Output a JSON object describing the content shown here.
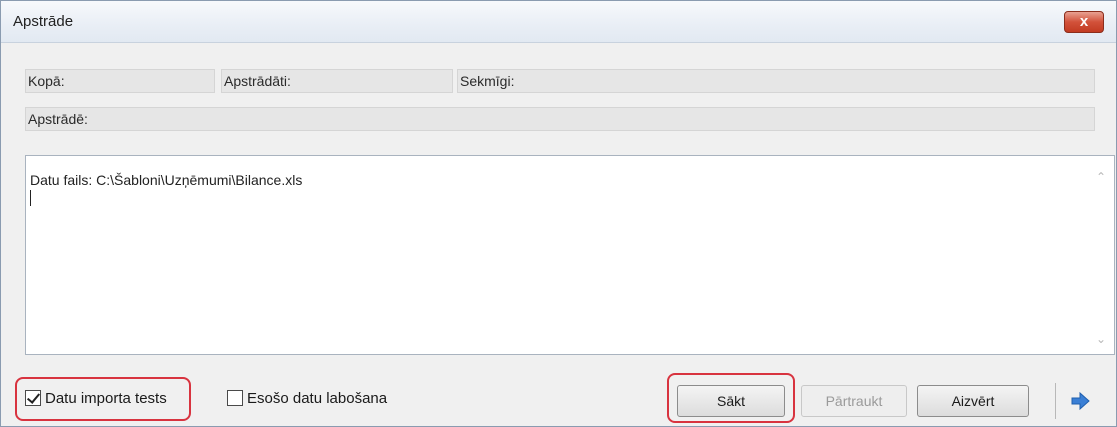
{
  "window": {
    "title": "Apstrāde",
    "close_label": "x"
  },
  "status": {
    "kopa_label": "Kopā:",
    "apstradati_label": "Apstrādāti:",
    "sekmigi_label": "Sekmīgi:",
    "apstrade_label": "Apstrādē:"
  },
  "log": {
    "text": "Datu fails: C:\\Šabloni\\Uzņēmumi\\Bilance.xls"
  },
  "options": {
    "test_label": "Datu importa tests",
    "test_checked": true,
    "esoso_label": "Esošo datu labošana",
    "esoso_checked": false
  },
  "buttons": {
    "start_label": "Sākt",
    "stop_label": "Pārtraukt",
    "close_label": "Aizvērt"
  },
  "colors": {
    "highlight": "#d8333f",
    "arrow": "#3a7fd5"
  },
  "icons": {
    "next": "arrow-right-icon"
  }
}
